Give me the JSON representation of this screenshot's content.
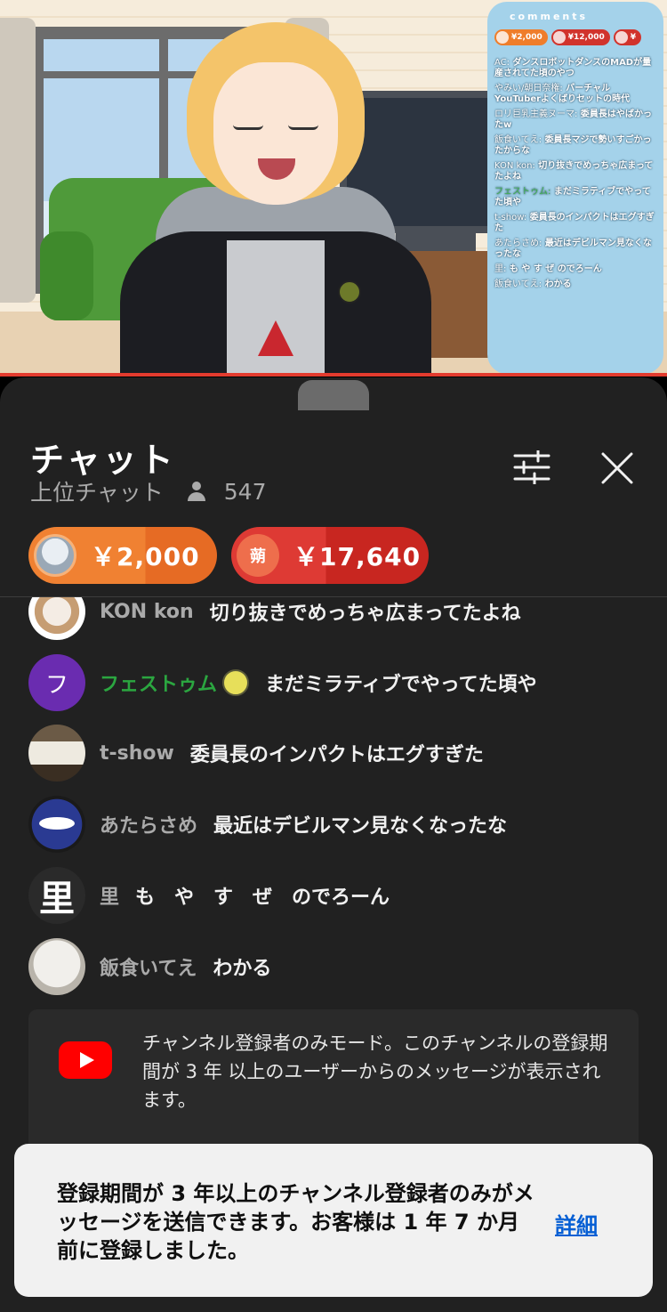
{
  "video": {
    "overlay": {
      "title": "comments",
      "chips": [
        {
          "amount": "¥2,000",
          "color": "#ef7d2a"
        },
        {
          "amount": "¥12,000",
          "color": "#d1332c"
        },
        {
          "amount": "¥",
          "color": "#d1332c"
        }
      ],
      "items": [
        {
          "name": "AC:",
          "text": "ダンスロボットダンスのMADが量産されてた頃のやつ"
        },
        {
          "name": "やみい/朝日奈権:",
          "text": "バーチャルYouTuberよくばりセットの時代"
        },
        {
          "name": "ロリ巨乳主義ヌーマ:",
          "text": "委員長はやばかったw"
        },
        {
          "name": "飯食いてえ:",
          "text": "委員長マジで勢いすごかったからな"
        },
        {
          "name": "KON kon:",
          "text": "切り抜きでめっちゃ広まってたよね"
        },
        {
          "name": "フェストゥム:",
          "text": "まだミラティブでやってた頃や",
          "member": true
        },
        {
          "name": "t-show:",
          "text": "委員長のインパクトはエグすぎた"
        },
        {
          "name": "あたらさめ:",
          "text": "最近はデビルマン見なくなったな"
        },
        {
          "name": "里:",
          "text": "も や す ぜ のでろーん"
        },
        {
          "name": "飯食いてえ:",
          "text": "わかる"
        }
      ]
    }
  },
  "chat": {
    "title": "チャット",
    "mode": "上位チャット",
    "viewer_count": "547",
    "filter_icon": "tune-icon",
    "close_icon": "close-icon",
    "super_chats": [
      {
        "amount": "￥2,000",
        "color": "#f08132"
      },
      {
        "amount": "￥17,640",
        "avatar_text": "蒴",
        "color": "#de3a34"
      }
    ],
    "messages": [
      {
        "author": "KON kon",
        "text": "切り抜きでめっちゃ広まってたよね"
      },
      {
        "author": "フェストゥム",
        "text": "まだミラティブでやってた頃や",
        "avatar_text": "フ",
        "member": true
      },
      {
        "author": "t-show",
        "text": "委員長のインパクトはエグすぎた"
      },
      {
        "author": "あたらさめ",
        "text": "最近はデビルマン見なくなったな"
      },
      {
        "author": "里",
        "text": "も　や　す　ぜ　のでろーん",
        "avatar_text": "里"
      },
      {
        "author": "飯食いてえ",
        "text": "わかる"
      }
    ],
    "notice": "チャンネル登録者のみモード。このチャンネルの登録期間が 3 年 以上のユーザーからのメッセージが表示されます。"
  },
  "toast": {
    "text": "登録期間が 3 年以上のチャンネル登録者のみがメッセージを送信できます。お客様は 1 年 7 か月前に登録しました。",
    "link": "詳細"
  },
  "colors": {
    "sheet_bg": "#212121",
    "member_name": "#2ba640",
    "link": "#065fd4",
    "progress": "#e33b2e"
  }
}
